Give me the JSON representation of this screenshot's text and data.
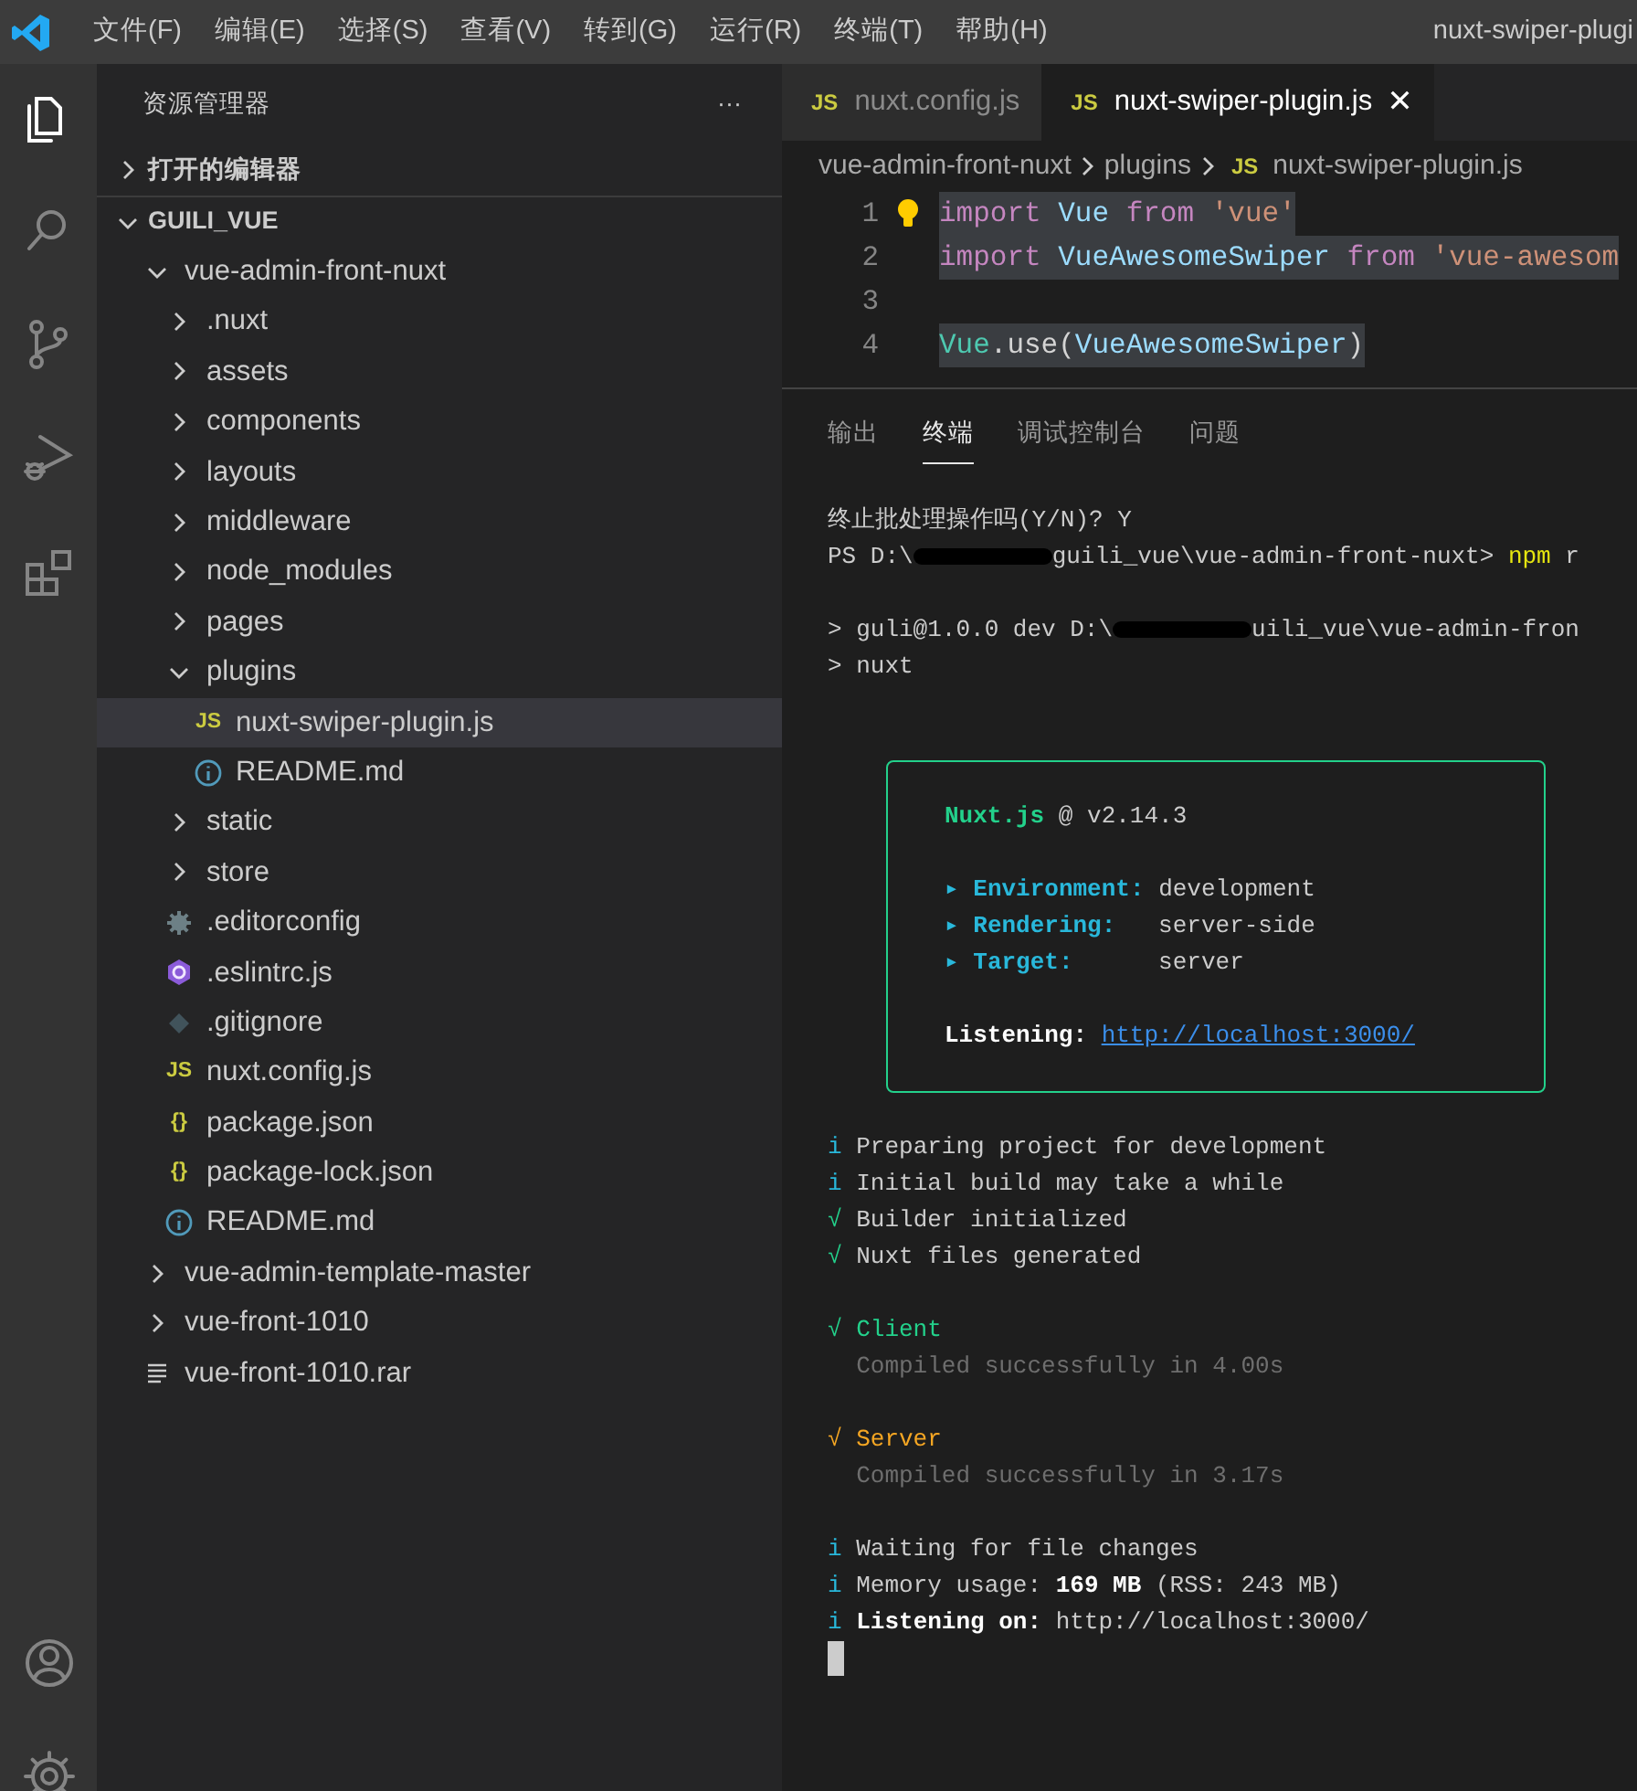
{
  "window": {
    "title": "nuxt-swiper-plugi"
  },
  "menu": [
    "文件(F)",
    "编辑(E)",
    "选择(S)",
    "查看(V)",
    "转到(G)",
    "运行(R)",
    "终端(T)",
    "帮助(H)"
  ],
  "activity_bar": {
    "top": [
      {
        "kind": "files",
        "selected": true
      },
      {
        "kind": "search",
        "selected": false
      },
      {
        "kind": "source-control",
        "selected": false
      },
      {
        "kind": "run",
        "selected": false
      },
      {
        "kind": "extensions",
        "selected": false
      }
    ],
    "bottom": [
      {
        "kind": "account"
      },
      {
        "kind": "settings"
      }
    ]
  },
  "sidebar": {
    "title": "资源管理器",
    "more": "···",
    "sections": [
      {
        "title": "打开的编辑器",
        "expanded": false
      },
      {
        "title": "GUILI_VUE",
        "expanded": true,
        "tree": [
          {
            "label": "vue-admin-front-nuxt",
            "kind": "folder",
            "expanded": true,
            "children": [
              {
                "label": ".nuxt",
                "kind": "folder",
                "expanded": false
              },
              {
                "label": "assets",
                "kind": "folder",
                "expanded": false
              },
              {
                "label": "components",
                "kind": "folder",
                "expanded": false
              },
              {
                "label": "layouts",
                "kind": "folder",
                "expanded": false
              },
              {
                "label": "middleware",
                "kind": "folder",
                "expanded": false
              },
              {
                "label": "node_modules",
                "kind": "folder",
                "expanded": false
              },
              {
                "label": "pages",
                "kind": "folder",
                "expanded": false
              },
              {
                "label": "plugins",
                "kind": "folder",
                "expanded": true,
                "children": [
                  {
                    "label": "nuxt-swiper-plugin.js",
                    "kind": "js",
                    "badge": "JS",
                    "selected": true
                  },
                  {
                    "label": "README.md",
                    "kind": "info",
                    "selected": false
                  }
                ]
              },
              {
                "label": "static",
                "kind": "folder",
                "expanded": false
              },
              {
                "label": "store",
                "kind": "folder",
                "expanded": false
              },
              {
                "label": ".editorconfig",
                "kind": "config",
                "selected": false
              },
              {
                "label": ".eslintrc.js",
                "kind": "eslint",
                "selected": false
              },
              {
                "label": ".gitignore",
                "kind": "git",
                "selected": false
              },
              {
                "label": "nuxt.config.js",
                "kind": "js",
                "badge": "JS",
                "selected": false
              },
              {
                "label": "package.json",
                "kind": "json",
                "badge": "{}",
                "selected": false
              },
              {
                "label": "package-lock.json",
                "kind": "json",
                "badge": "{}",
                "selected": false
              },
              {
                "label": "README.md",
                "kind": "info",
                "selected": false
              }
            ]
          },
          {
            "label": "vue-admin-template-master",
            "kind": "folder",
            "expanded": false
          },
          {
            "label": "vue-front-1010",
            "kind": "folder",
            "expanded": false
          },
          {
            "label": "vue-front-1010.rar",
            "kind": "archive",
            "selected": false
          }
        ]
      }
    ]
  },
  "editor": {
    "tabs": [
      {
        "label": "nuxt.config.js",
        "badge": "JS",
        "selected": false
      },
      {
        "label": "nuxt-swiper-plugin.js",
        "badge": "JS",
        "selected": true,
        "close": "✕"
      }
    ],
    "breadcrumb": [
      {
        "label": "vue-admin-front-nuxt"
      },
      {
        "label": "plugins"
      },
      {
        "label": "nuxt-swiper-plugin.js",
        "badge": "JS"
      }
    ],
    "lines": [
      {
        "number": "1",
        "highlighted": true,
        "tokens": [
          {
            "text": "import",
            "kind": "keyword"
          },
          {
            "text": " Vue",
            "kind": "ident"
          },
          {
            "text": " from",
            "kind": "keyword"
          },
          {
            "text": " 'vue'",
            "kind": "string"
          }
        ]
      },
      {
        "number": "2",
        "highlighted": true,
        "tokens": [
          {
            "text": "import",
            "kind": "keyword"
          },
          {
            "text": " VueAwesomeSwiper",
            "kind": "ident"
          },
          {
            "text": " from",
            "kind": "keyword"
          },
          {
            "text": " 'vue-awesom",
            "kind": "string"
          }
        ]
      },
      {
        "number": "3"
      },
      {
        "number": "4",
        "highlighted": true,
        "tokens": [
          {
            "text": "Vue",
            "kind": "type"
          },
          {
            "text": ".use(",
            "kind": "plain"
          },
          {
            "text": "VueAwesomeSwiper",
            "kind": "ident"
          },
          {
            "text": ")",
            "kind": "plain"
          }
        ]
      }
    ]
  },
  "panel": {
    "tabs": [
      {
        "label": "输出",
        "selected": false
      },
      {
        "label": "终端",
        "selected": true
      },
      {
        "label": "调试控制台",
        "selected": false
      },
      {
        "label": "问题",
        "selected": false
      }
    ],
    "terminal": {
      "lines": [
        {
          "segments": [
            {
              "text": "终止批处理操作吗(Y/N)? Y",
              "kind": "plain"
            }
          ]
        },
        {
          "segments": [
            {
              "text": "PS D:\\",
              "kind": "plain"
            },
            {
              "kind": "redacted"
            },
            {
              "text": "guili_vue\\vue-admin-front-nuxt> ",
              "kind": "plain"
            },
            {
              "text": "npm",
              "kind": "cmd"
            },
            {
              "text": " r",
              "kind": "plain"
            }
          ]
        },
        {
          "gap_before": true,
          "segments": [
            {
              "text": "> guli@1.0.0 dev D:\\",
              "kind": "plain"
            },
            {
              "kind": "redacted"
            },
            {
              "text": "uili_vue\\vue-admin-fron",
              "kind": "plain"
            }
          ]
        },
        {
          "segments": [
            {
              "text": "> nuxt",
              "kind": "plain"
            }
          ]
        }
      ],
      "banner": {
        "lines": [
          {
            "segments": [
              {
                "text": "Nuxt.js",
                "kind": "title"
              },
              {
                "text": " @ v2.14.3",
                "kind": "plain"
              }
            ]
          },
          {
            "gap_before": true,
            "segments": [
              {
                "text": "▸ ",
                "kind": "info"
              },
              {
                "text": "Environment:",
                "kind": "label"
              },
              {
                "text": " development",
                "kind": "plain"
              }
            ]
          },
          {
            "segments": [
              {
                "text": "▸ ",
                "kind": "info"
              },
              {
                "text": "Rendering:",
                "kind": "label"
              },
              {
                "text": "   server-side",
                "kind": "plain"
              }
            ]
          },
          {
            "segments": [
              {
                "text": "▸ ",
                "kind": "info"
              },
              {
                "text": "Target:",
                "kind": "label"
              },
              {
                "text": "      server",
                "kind": "plain"
              }
            ]
          },
          {
            "gap_before": true,
            "segments": [
              {
                "text": "Listening: ",
                "kind": "strong"
              },
              {
                "text": "http://localhost:3000/",
                "kind": "link"
              }
            ]
          }
        ]
      },
      "log": [
        {
          "segments": [
            {
              "text": "i",
              "kind": "info"
            },
            {
              "text": " Preparing project for development",
              "kind": "plain"
            }
          ]
        },
        {
          "segments": [
            {
              "text": "i",
              "kind": "info"
            },
            {
              "text": " Initial build may take a while",
              "kind": "plain"
            }
          ]
        },
        {
          "segments": [
            {
              "text": "√",
              "kind": "ok"
            },
            {
              "text": " Builder initialized",
              "kind": "plain"
            }
          ]
        },
        {
          "segments": [
            {
              "text": "√",
              "kind": "ok"
            },
            {
              "text": " Nuxt files generated",
              "kind": "plain"
            }
          ]
        },
        {
          "gap_before": true,
          "segments": [
            {
              "text": "√ Client",
              "kind": "ok"
            }
          ]
        },
        {
          "segments": [
            {
              "text": "  Compiled successfully in 4.00s",
              "kind": "muted"
            }
          ]
        },
        {
          "gap_before": true,
          "segments": [
            {
              "text": "√ Server",
              "kind": "warn"
            }
          ]
        },
        {
          "segments": [
            {
              "text": "  Compiled successfully in 3.17s",
              "kind": "muted"
            }
          ]
        },
        {
          "gap_before": true,
          "segments": [
            {
              "text": "i",
              "kind": "info"
            },
            {
              "text": " Waiting for file changes",
              "kind": "plain"
            }
          ]
        },
        {
          "segments": [
            {
              "text": "i",
              "kind": "info"
            },
            {
              "text": " Memory usage: ",
              "kind": "plain"
            },
            {
              "text": "169 MB",
              "kind": "strong"
            },
            {
              "text": " (RSS: 243 MB)",
              "kind": "plain"
            }
          ]
        },
        {
          "segments": [
            {
              "text": "i",
              "kind": "info"
            },
            {
              "text": " Listening on:",
              "kind": "strong"
            },
            {
              "text": " http://localhost:3000/",
              "kind": "plain"
            }
          ]
        }
      ]
    }
  }
}
